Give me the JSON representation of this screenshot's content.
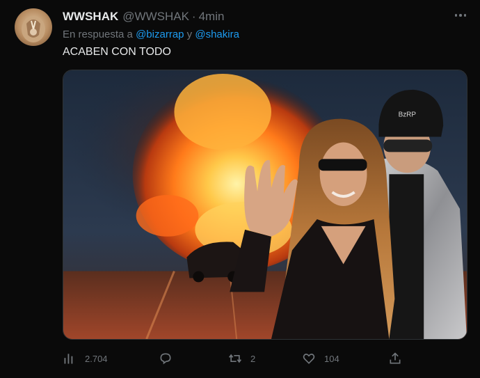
{
  "tweet": {
    "display_name": "WWSHAK",
    "handle": "@WWSHAK",
    "separator": "·",
    "time": "4min",
    "reply_prefix": "En respuesta a",
    "reply_mention_1": "@bizarrap",
    "reply_connector": "y",
    "reply_mention_2": "@shakira",
    "text": "ACABEN CON TODO",
    "media_caption_cap": "BzRP"
  },
  "actions": {
    "views": {
      "icon": "views-icon",
      "count": "2.704"
    },
    "reply": {
      "icon": "reply-icon",
      "count": ""
    },
    "retweet": {
      "icon": "retweet-icon",
      "count": "2"
    },
    "like": {
      "icon": "heart-icon",
      "count": "104"
    },
    "share": {
      "icon": "share-icon",
      "count": ""
    }
  },
  "colors": {
    "background": "#0a0a0a",
    "text_primary": "#e7e9ea",
    "text_secondary": "#71767b",
    "accent": "#1d9bf0"
  }
}
